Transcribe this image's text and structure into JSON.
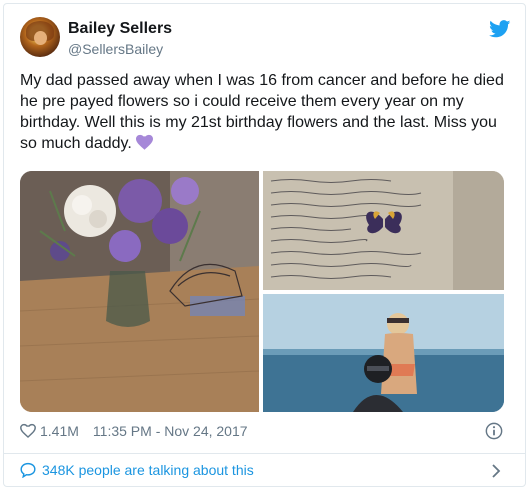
{
  "author": {
    "name": "Bailey Sellers",
    "handle": "@SellersBailey"
  },
  "tweet": {
    "text": "My dad passed away when I was 16 from cancer and before he died he pre payed flowers so i could receive them every year on my birthday. Well this is my 21st birthday flowers and the last. Miss you so much daddy.",
    "emoji": "purple-heart-icon"
  },
  "media": {
    "photos": [
      "flowers-vase-photo",
      "handwritten-note-photo",
      "beach-father-daughter-photo"
    ]
  },
  "meta": {
    "likes": "1.41M",
    "timestamp": "11:35 PM - Nov 24, 2017"
  },
  "footer": {
    "talking": "348K people are talking about this"
  },
  "colors": {
    "brand": "#1da1f2",
    "link": "#1b95e0",
    "secondary_text": "#657786",
    "emoji_heart": "#a688d8"
  }
}
